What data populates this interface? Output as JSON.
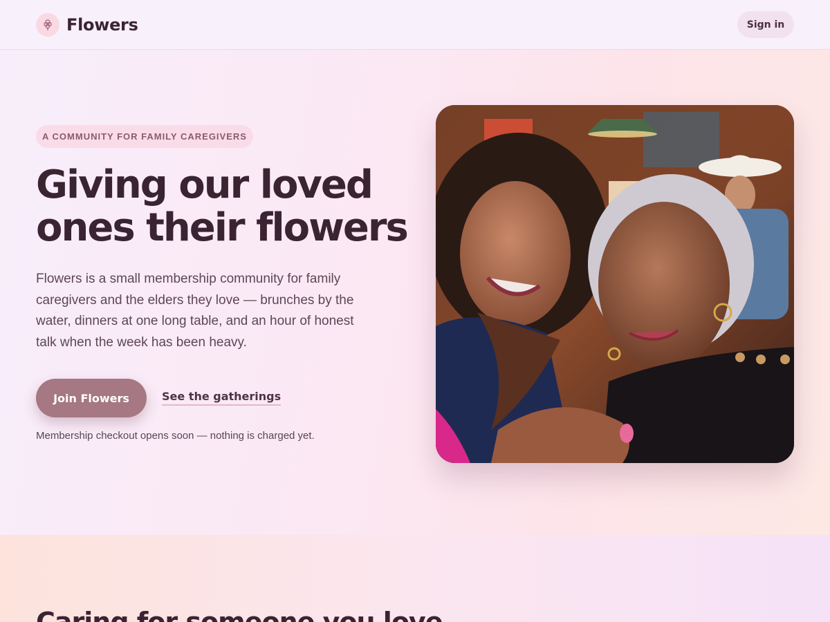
{
  "header": {
    "brand_name": "Flowers",
    "signin_label": "Sign in"
  },
  "hero": {
    "eyebrow": "A COMMUNITY FOR FAMILY CAREGIVERS",
    "title_line1": "Giving our loved",
    "title_line2": "ones their flowers",
    "description": "Flowers is a small membership community for family caregivers and the elders they love — brunches by the water, dinners at one long table, and an hour of honest talk when the week has been heavy.",
    "join_label": "Join Flowers",
    "gatherings_label": "See the gatherings",
    "note": "Membership checkout opens soon — nothing is charged yet."
  },
  "section2": {
    "title": "Caring for someone you love"
  },
  "icons": {
    "brand": "flower-icon"
  },
  "colors": {
    "accent": "#a57883",
    "ink": "#3a2432",
    "eyebrow_bg": "#f9dce7"
  }
}
